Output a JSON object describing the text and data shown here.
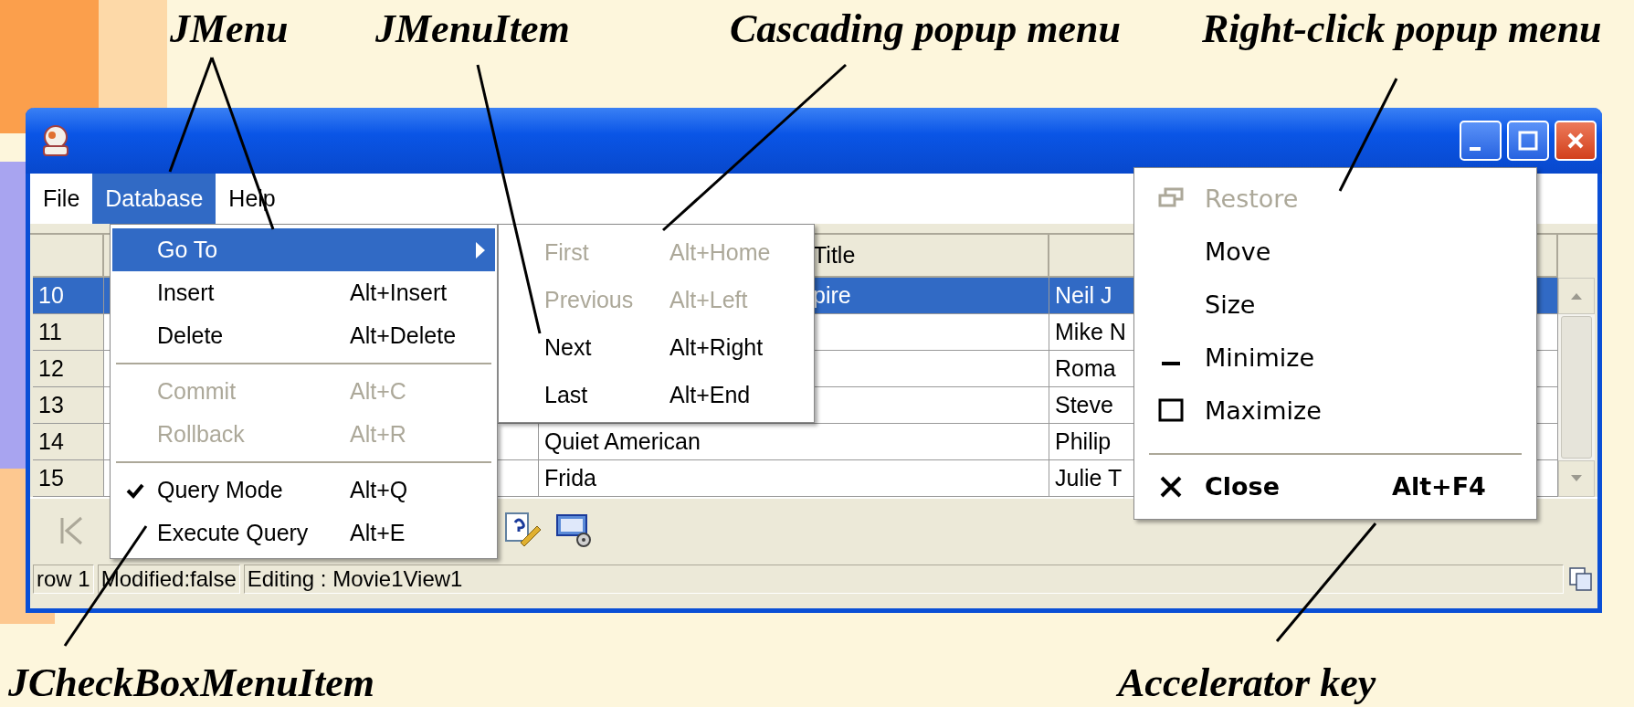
{
  "annotations": [
    {
      "text": "JMenu"
    },
    {
      "text": "JMenuItem"
    },
    {
      "text": "Cascading popup menu"
    },
    {
      "text": "Right-click popup menu"
    },
    {
      "text": "JCheckBoxMenuItem"
    },
    {
      "text": "Accelerator key"
    }
  ],
  "menu_bar": [
    {
      "label": "File",
      "selected": false
    },
    {
      "label": "Database",
      "selected": true
    },
    {
      "label": "Help",
      "selected": false
    }
  ],
  "table": {
    "column_3": "Title",
    "rows": [
      {
        "number": "10",
        "selected": true,
        "column_3": "pire",
        "column_4": "Neil J"
      },
      {
        "number": "11",
        "selected": false,
        "column_4": "Mike N"
      },
      {
        "number": "12",
        "selected": false,
        "column_4": "Roma"
      },
      {
        "number": "13",
        "selected": false,
        "column_4": "Steve"
      },
      {
        "number": "14",
        "selected": false,
        "column_3": "Quiet American",
        "column_4": "Philip"
      },
      {
        "number": "15",
        "selected": false,
        "column_3": "Frida",
        "column_4": "Julie T"
      }
    ]
  },
  "status_bar": [
    "row 1",
    "Modified:false",
    "Editing : Movie1View1"
  ],
  "database_menu": [
    {
      "kind": "submenu",
      "label": "Go To",
      "selected": true,
      "disabled": false
    },
    {
      "kind": "item",
      "label": "Insert",
      "accelerator": "Alt+Insert",
      "selected": false,
      "disabled": false
    },
    {
      "kind": "item",
      "label": "Delete",
      "accelerator": "Alt+Delete",
      "selected": false,
      "disabled": false
    },
    {
      "kind": "separator"
    },
    {
      "kind": "item",
      "label": "Commit",
      "accelerator": "Alt+C",
      "selected": false,
      "disabled": true
    },
    {
      "kind": "item",
      "label": "Rollback",
      "accelerator": "Alt+R",
      "selected": false,
      "disabled": true
    },
    {
      "kind": "separator"
    },
    {
      "kind": "check",
      "label": "Query Mode",
      "accelerator": "Alt+Q",
      "selected": false,
      "disabled": false,
      "checked": true
    },
    {
      "kind": "item",
      "label": "Execute Query",
      "accelerator": "Alt+E",
      "selected": false,
      "disabled": false
    }
  ],
  "go_to_menu": [
    {
      "kind": "item",
      "label": "First",
      "accelerator": "Alt+Home",
      "selected": false,
      "disabled": true
    },
    {
      "kind": "item",
      "label": "Previous",
      "accelerator": "Alt+Left",
      "selected": false,
      "disabled": true
    },
    {
      "kind": "item",
      "label": "Next",
      "accelerator": "Alt+Right",
      "selected": false,
      "disabled": false
    },
    {
      "kind": "item",
      "label": "Last",
      "accelerator": "Alt+End",
      "selected": false,
      "disabled": false
    }
  ],
  "window_menu": [
    {
      "kind": "restore",
      "label": "Restore",
      "selected": false,
      "disabled": true
    },
    {
      "kind": "item",
      "label": "Move",
      "selected": false,
      "disabled": false
    },
    {
      "kind": "item",
      "label": "Size",
      "selected": false,
      "disabled": false
    },
    {
      "kind": "minimize",
      "label": "Minimize",
      "selected": false,
      "disabled": false
    },
    {
      "kind": "maximize",
      "label": "Maximize",
      "selected": false,
      "disabled": false
    },
    {
      "kind": "separator"
    },
    {
      "kind": "close",
      "label": "Close",
      "accelerator": "Alt+F4",
      "selected": false,
      "disabled": false
    }
  ]
}
